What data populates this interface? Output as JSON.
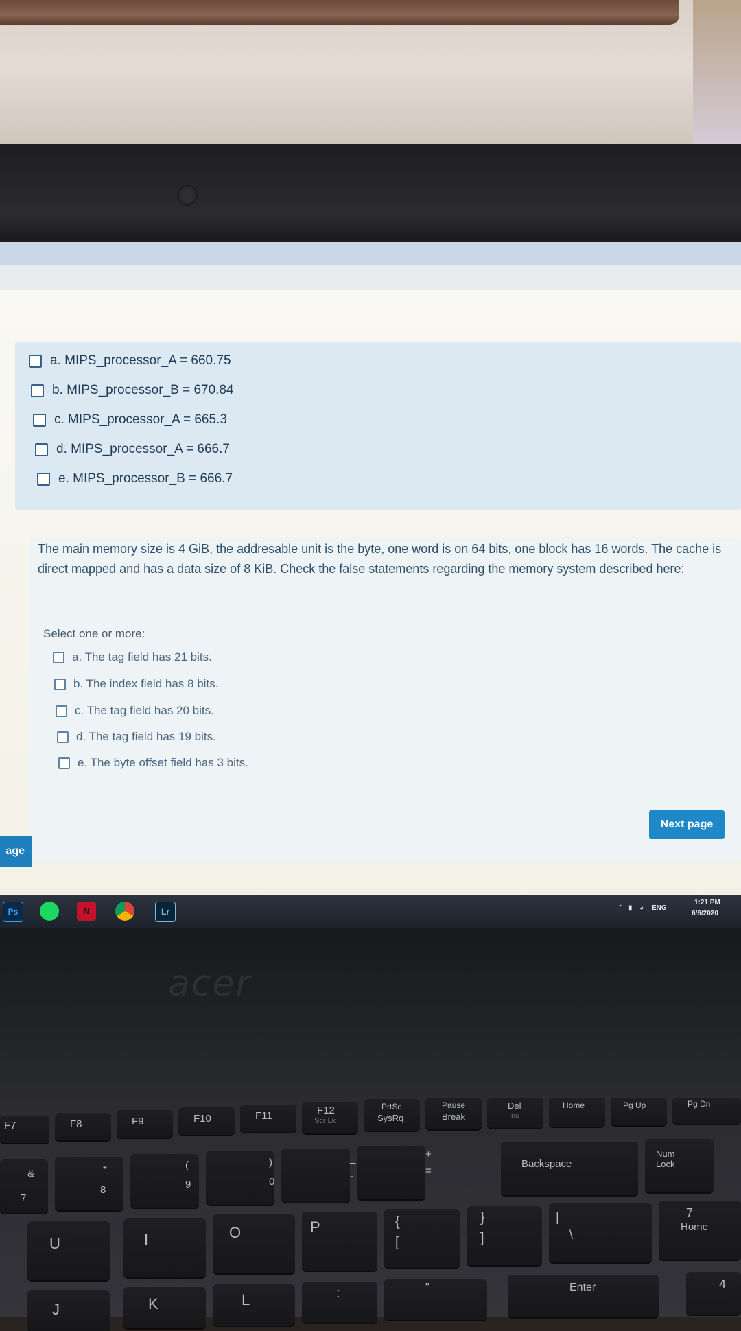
{
  "quiz": {
    "previous_options": [
      "a. MIPS_processor_A = 660.75",
      "b. MIPS_processor_B = 670.84",
      "c. MIPS_processor_A = 665.3",
      "d. MIPS_processor_A = 666.7",
      "e. MIPS_processor_B = 666.7"
    ],
    "question_text": "The main memory size is 4 GiB, the addresable unit is the byte, one word is on 64 bits, one block has 16 words. The cache is direct mapped and has a data size of 8 KiB. Check the false statements regarding the memory system described here:",
    "select_label": "Select one or more:",
    "options": [
      "a. The tag field has 21 bits.",
      "b. The index field has 8 bits.",
      "c. The tag field has 20 bits.",
      "d. The tag field has 19 bits.",
      "e. The byte offset field has 3 bits."
    ],
    "next_button": "Next page",
    "side_tab": "age"
  },
  "taskbar": {
    "icons": [
      "Ps",
      "N",
      "Lr"
    ],
    "language": "ENG",
    "time": "1:21 PM",
    "date": "6/6/2020"
  },
  "laptop": {
    "brand": "acer"
  },
  "keyboard": {
    "function_row": [
      "F7",
      "F8",
      "F9",
      "F10",
      "F11",
      "F12",
      "PrtSc",
      "Pause",
      "Del",
      "Home",
      "Pg Up",
      "Pg Dn"
    ],
    "function_row_sub": [
      "Scr Lk",
      "SysRq",
      "Break",
      "Ins"
    ],
    "number_row": [
      "&",
      "7",
      "*",
      "8",
      "(",
      "9",
      ")",
      "0",
      "_",
      "-",
      "+",
      "=",
      "Backspace",
      "Num Lock"
    ],
    "letter_row": [
      "U",
      "I",
      "O",
      "P",
      "{",
      "[",
      "}",
      "]",
      "|",
      "\\",
      "7",
      "Home"
    ],
    "bottom_row": [
      "J",
      "K",
      "L",
      ":",
      "\"",
      "Enter",
      "4"
    ]
  }
}
